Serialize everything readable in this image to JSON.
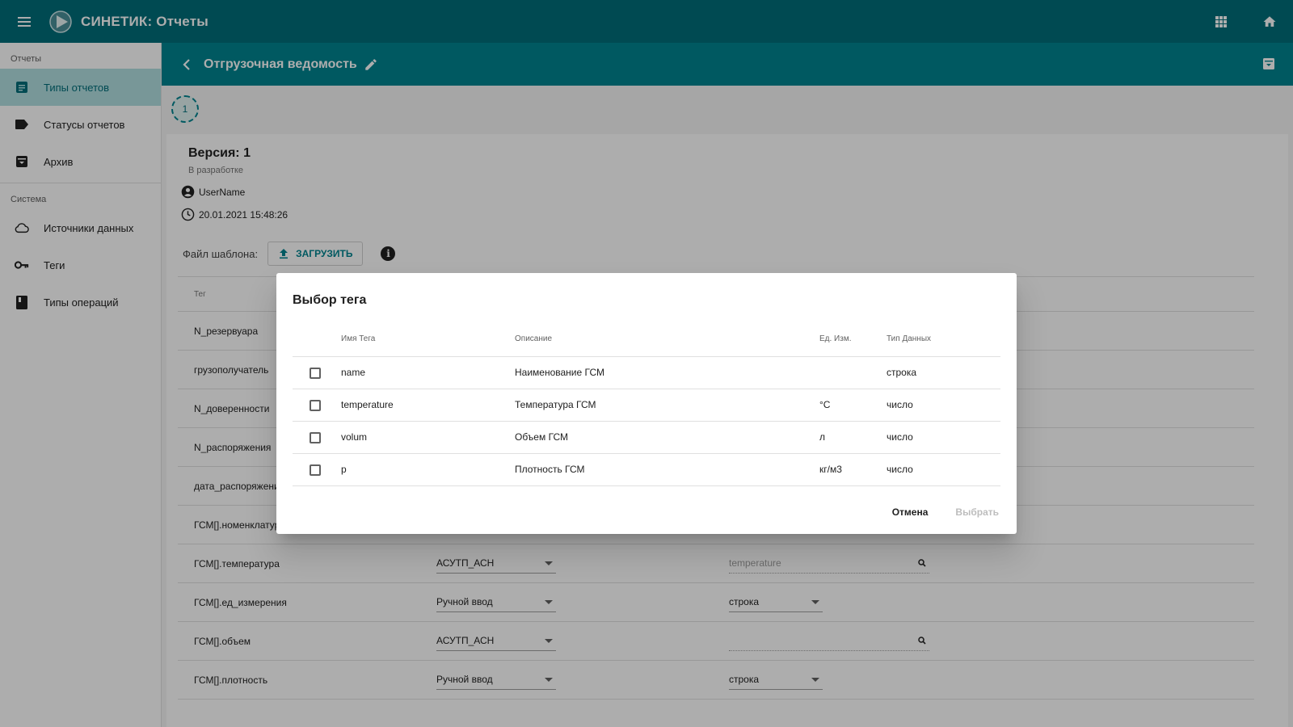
{
  "app": {
    "title": "СИНЕТИК: Отчеты"
  },
  "sidebar": {
    "sections": [
      {
        "title": "Отчеты",
        "items": [
          {
            "label": "Типы отчетов",
            "icon": "list-icon",
            "active": true
          },
          {
            "label": "Статусы отчетов",
            "icon": "label-icon"
          },
          {
            "label": "Архив",
            "icon": "archive-icon"
          }
        ]
      },
      {
        "title": "Система",
        "items": [
          {
            "label": "Источники данных",
            "icon": "cloud-icon"
          },
          {
            "label": "Теги",
            "icon": "key-icon"
          },
          {
            "label": "Типы операций",
            "icon": "book-icon"
          }
        ]
      }
    ]
  },
  "page": {
    "title": "Отгрузочная ведомость"
  },
  "version": {
    "chip": "1",
    "title": "Версия: 1",
    "status": "В разработке",
    "user": "UserName",
    "datetime": "20.01.2021 15:48:26"
  },
  "template": {
    "label": "Файл шаблона:",
    "upload_label": "ЗАГРУЗИТЬ",
    "info": "i"
  },
  "tags_table": {
    "header": "Тег",
    "rows": [
      {
        "name": "N_резервуара"
      },
      {
        "name": "грузополучатель"
      },
      {
        "name": "N_доверенности"
      },
      {
        "name": "N_распоряжения"
      },
      {
        "name": "дата_распоряжения"
      },
      {
        "name": "ГСМ[].номенклатура"
      },
      {
        "name": "ГСМ[].температура",
        "source": "АСУТП_АСН",
        "value": "temperature",
        "value_kind": "search"
      },
      {
        "name": "ГСМ[].ед_измерения",
        "source": "Ручной ввод",
        "value": "строка",
        "value_kind": "select"
      },
      {
        "name": "ГСМ[].объем",
        "source": "АСУТП_АСН",
        "value": "",
        "value_kind": "search"
      },
      {
        "name": "ГСМ[].плотность",
        "source": "Ручной ввод",
        "value": "строка",
        "value_kind": "select"
      }
    ]
  },
  "dialog": {
    "title": "Выбор тега",
    "columns": {
      "name": "Имя Тега",
      "desc": "Описание",
      "unit": "Ед. Изм.",
      "type": "Тип Данных"
    },
    "rows": [
      {
        "name": "name",
        "desc": "Наименование ГСМ",
        "unit": "",
        "type": "строка",
        "checked": false
      },
      {
        "name": "temperature",
        "desc": "Температура ГСМ",
        "unit": "°C",
        "type": "число",
        "checked": false
      },
      {
        "name": "volum",
        "desc": "Объем ГСМ",
        "unit": "л",
        "type": "число",
        "checked": false
      },
      {
        "name": "p",
        "desc": "Плотность ГСМ",
        "unit": "кг/м3",
        "type": "число",
        "checked": false
      }
    ],
    "cancel_label": "Отмена",
    "choose_label": "Выбрать"
  },
  "colors": {
    "primary": "#006e7a",
    "header": "#00838f",
    "active_bg": "#b2dfe1"
  }
}
